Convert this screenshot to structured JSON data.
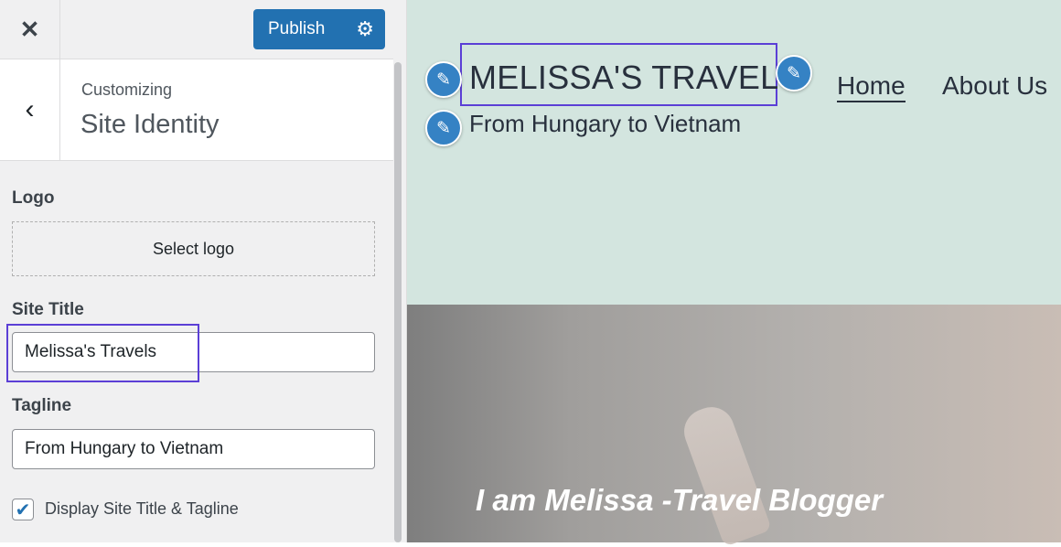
{
  "sidebar": {
    "close_icon": "close-icon",
    "publish_label": "Publish",
    "settings_icon": "gear-icon",
    "back_icon": "chevron-left-icon",
    "customizing": "Customizing",
    "section_title": "Site Identity",
    "logo_label": "Logo",
    "select_logo": "Select logo",
    "site_title_label": "Site Title",
    "site_title_value": "Melissa's Travels",
    "tagline_label": "Tagline",
    "tagline_value": "From Hungary to Vietnam",
    "display_checkbox_label": "Display Site Title & Tagline",
    "display_checked": true
  },
  "preview": {
    "site_title": "MELISSA'S TRAVELS",
    "tagline": "From Hungary to Vietnam",
    "nav": [
      "Home",
      "About Us"
    ],
    "hero_text": "I am Melissa -Travel Blogger",
    "edit_icon": "pencil-icon"
  },
  "colors": {
    "accent": "#2271b1",
    "highlight": "#5b3fd6",
    "header_bg": "#d3e5df"
  }
}
